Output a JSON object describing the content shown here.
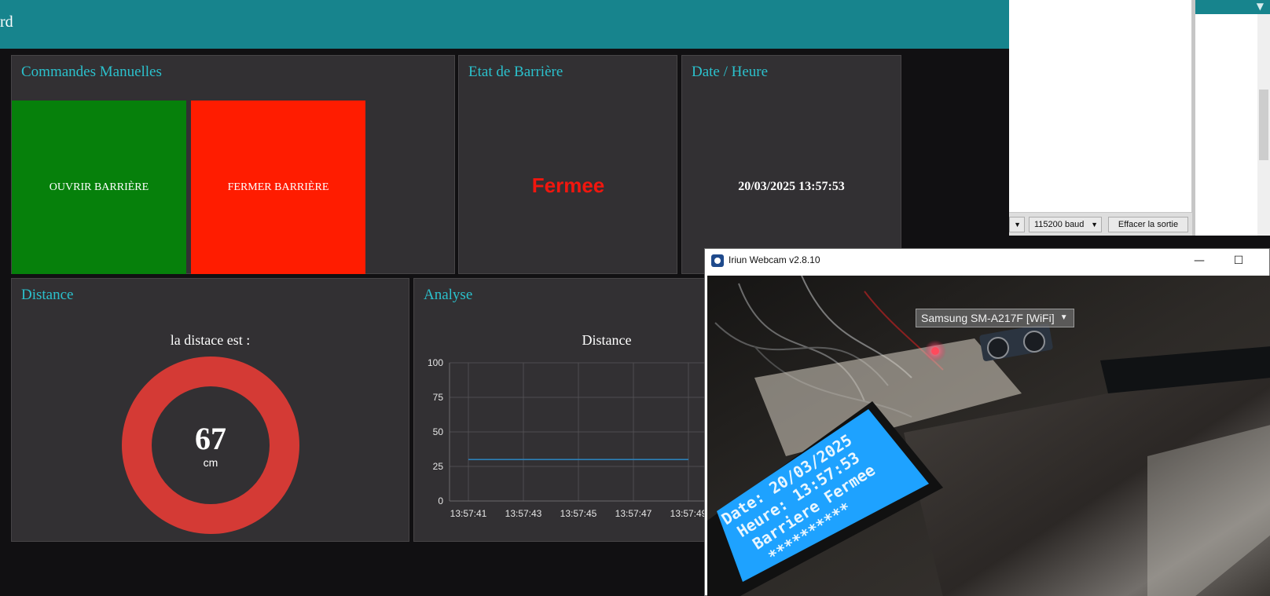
{
  "header": {
    "title": "rd"
  },
  "commandes": {
    "title": "Commandes Manuelles",
    "open_label": "OUVRIR BARRIÈRE",
    "close_label": "FERMER BARRIÈRE"
  },
  "etat": {
    "title": "Etat de Barrière",
    "value": "Fermee"
  },
  "datetime": {
    "title": "Date / Heure",
    "value": "20/03/2025 13:57:53"
  },
  "distance": {
    "title": "Distance",
    "label": "la distace est :",
    "value": "67",
    "unit": "cm",
    "color": "#d43a35"
  },
  "analyse": {
    "title": "Analyse"
  },
  "chart_data": {
    "type": "line",
    "title": "Distance",
    "x": [
      "13:57:41",
      "13:57:43",
      "13:57:45",
      "13:57:47",
      "13:57:49"
    ],
    "yticks": [
      "0",
      "25",
      "50",
      "75",
      "100"
    ],
    "ylim": [
      0,
      100
    ],
    "series": [
      {
        "values": [
          30,
          30,
          30,
          30,
          30
        ],
        "color": "#2c7fb8"
      }
    ],
    "grid": true
  },
  "serial": {
    "selector_value": "",
    "baud": "115200 baud",
    "clear_label": "Effacer la sortie"
  },
  "webcam": {
    "title": "Iriun Webcam v2.8.10",
    "device": "Samsung SM-A217F [WiFi]",
    "lcd_lines": [
      "Date: 20/03/2025",
      "Heure: 13:57:53",
      "Barriere Fermee",
      "**********"
    ]
  }
}
